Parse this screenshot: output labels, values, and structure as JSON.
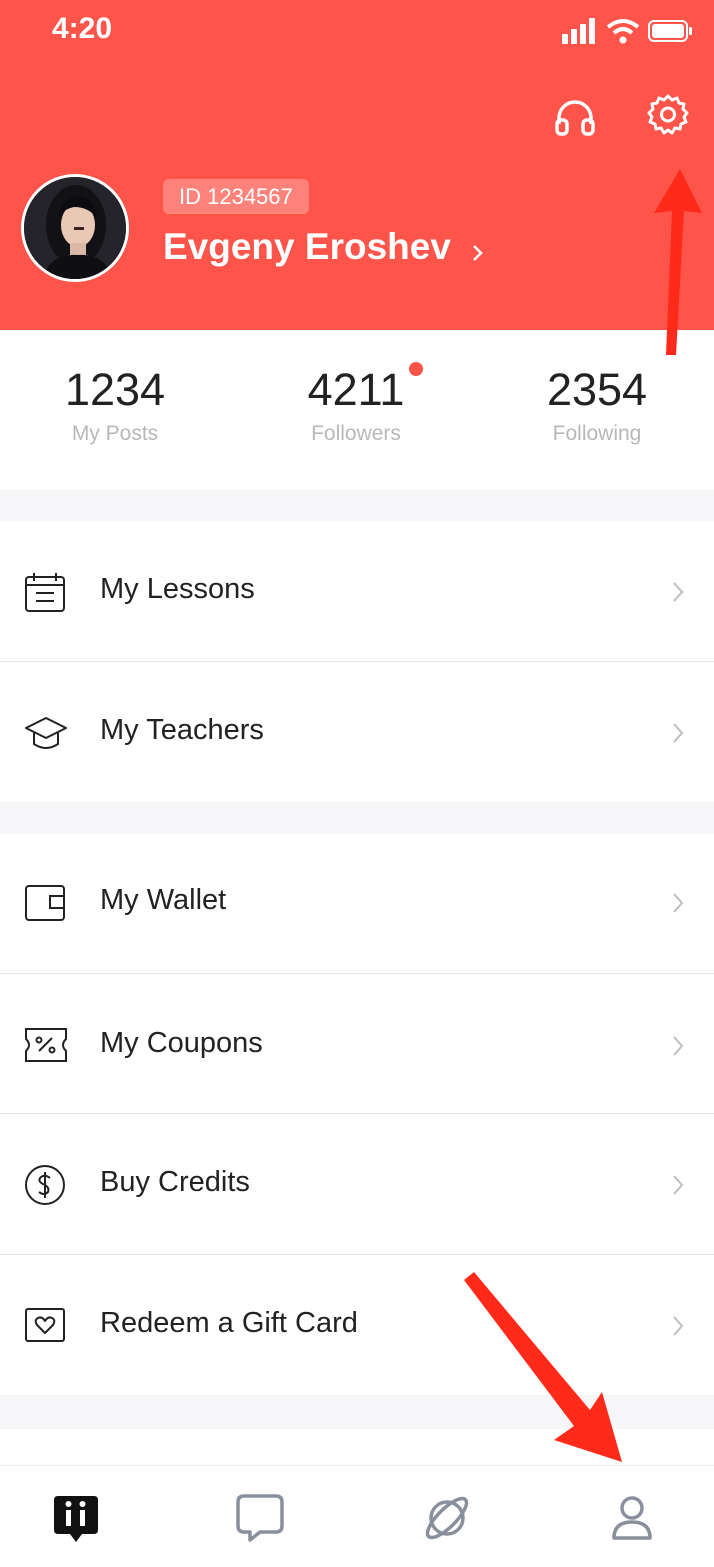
{
  "status": {
    "time": "4:20"
  },
  "header": {
    "support_icon": "headphones-icon",
    "settings_icon": "gear-icon",
    "id_badge": "ID 1234567",
    "name": "Evgeny Eroshev",
    "name_chevron": "›"
  },
  "stats": [
    {
      "value": "1234",
      "label": "My Posts"
    },
    {
      "value": "4211",
      "label": "Followers",
      "badge": true
    },
    {
      "value": "2354",
      "label": "Following"
    }
  ],
  "menu": {
    "lessons": {
      "label": "My Lessons",
      "icon": "calendar-icon"
    },
    "teachers": {
      "label": "My Teachers",
      "icon": "graduation-cap-icon"
    },
    "wallet": {
      "label": "My Wallet",
      "icon": "wallet-icon"
    },
    "coupons": {
      "label": "My Coupons",
      "icon": "coupon-icon"
    },
    "credits": {
      "label": "Buy Credits",
      "icon": "dollar-icon"
    },
    "giftcard": {
      "label": "Redeem a Gift Card",
      "icon": "gift-card-icon"
    }
  },
  "tabbar": {
    "items": [
      {
        "icon": "app-logo-icon",
        "active": true
      },
      {
        "icon": "chat-bubble-icon",
        "active": false
      },
      {
        "icon": "planet-icon",
        "active": false
      },
      {
        "icon": "profile-icon",
        "active": false
      }
    ]
  },
  "colors": {
    "accent": "#FF5449",
    "annotation_arrow": "#FF2A1A"
  }
}
